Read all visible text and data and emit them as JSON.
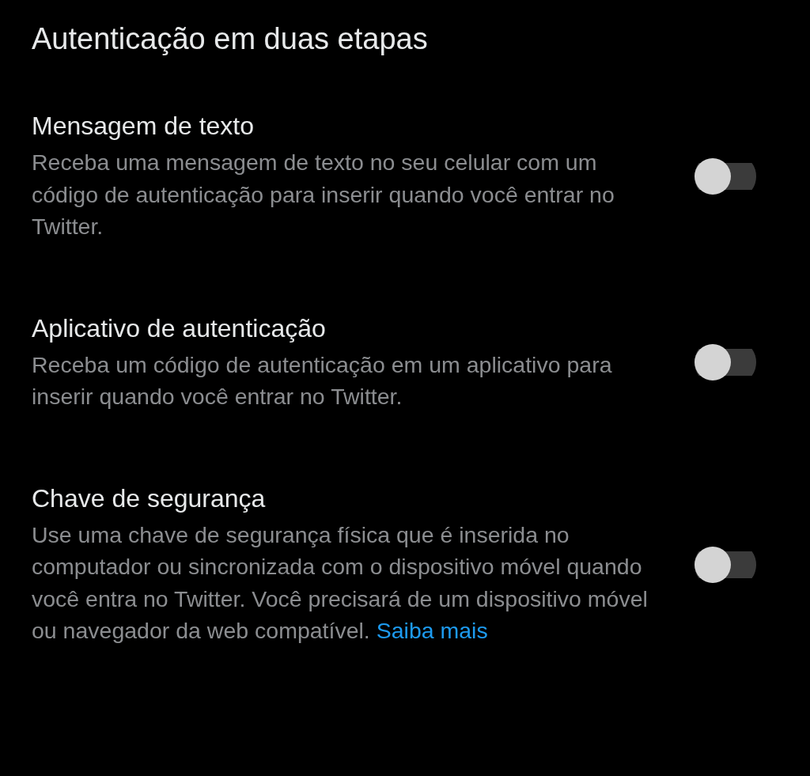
{
  "title": "Autenticação em duas etapas",
  "options": [
    {
      "title": "Mensagem de texto",
      "description": "Receba uma mensagem de texto no seu celular com um código de autenticação para inserir quando você entrar no Twitter.",
      "on": false
    },
    {
      "title": "Aplicativo de autenticação",
      "description": "Receba um código de autenticação em um aplicativo para inserir quando você entrar no Twitter.",
      "on": false
    },
    {
      "title": "Chave de segurança",
      "description": "Use uma chave de segurança física que é inserida no computador ou sincronizada com o dispositivo móvel quando você entra no Twitter. Você precisará de um dispositivo móvel ou navegador da web compatível.",
      "link": "Saiba mais",
      "on": false
    }
  ]
}
